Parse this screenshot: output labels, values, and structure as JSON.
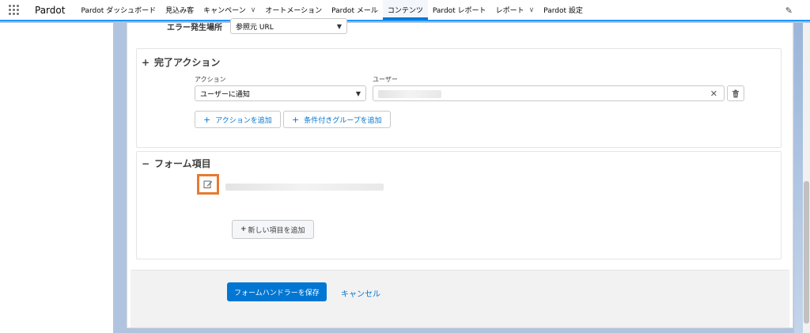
{
  "app": {
    "name": "Pardot"
  },
  "nav": {
    "items": [
      {
        "label": "Pardot ダッシュボード",
        "dropdown": false,
        "active": false
      },
      {
        "label": "見込み客",
        "dropdown": false,
        "active": false
      },
      {
        "label": "キャンペーン",
        "dropdown": true,
        "active": false
      },
      {
        "label": "オートメーション",
        "dropdown": false,
        "active": false
      },
      {
        "label": "Pardot メール",
        "dropdown": false,
        "active": false
      },
      {
        "label": "コンテンツ",
        "dropdown": false,
        "active": true
      },
      {
        "label": "Pardot レポート",
        "dropdown": false,
        "active": false
      },
      {
        "label": "レポート",
        "dropdown": true,
        "active": false
      },
      {
        "label": "Pardot 設定",
        "dropdown": false,
        "active": false
      }
    ]
  },
  "error_location": {
    "label": "エラー発生場所",
    "value": "参照元 URL"
  },
  "completion_actions": {
    "title": "完了アクション",
    "toggle": "+",
    "action_label": "アクション",
    "action_value": "ユーザーに通知",
    "user_label": "ユーザー",
    "add_action_label": "アクションを追加",
    "add_group_label": "条件付きグループを追加"
  },
  "form_fields": {
    "title": "フォーム項目",
    "toggle": "−",
    "add_field_label": "新しい項目を追加"
  },
  "footer": {
    "save_label": "フォームハンドラーを保存",
    "cancel_label": "キャンセル"
  },
  "colors": {
    "brand": "#0176d3",
    "highlight": "#e87a2f"
  },
  "icons": [
    "app-launcher-icon",
    "chevron-down-icon",
    "pencil-icon",
    "close-icon",
    "trash-icon",
    "edit-icon",
    "plus-icon"
  ]
}
